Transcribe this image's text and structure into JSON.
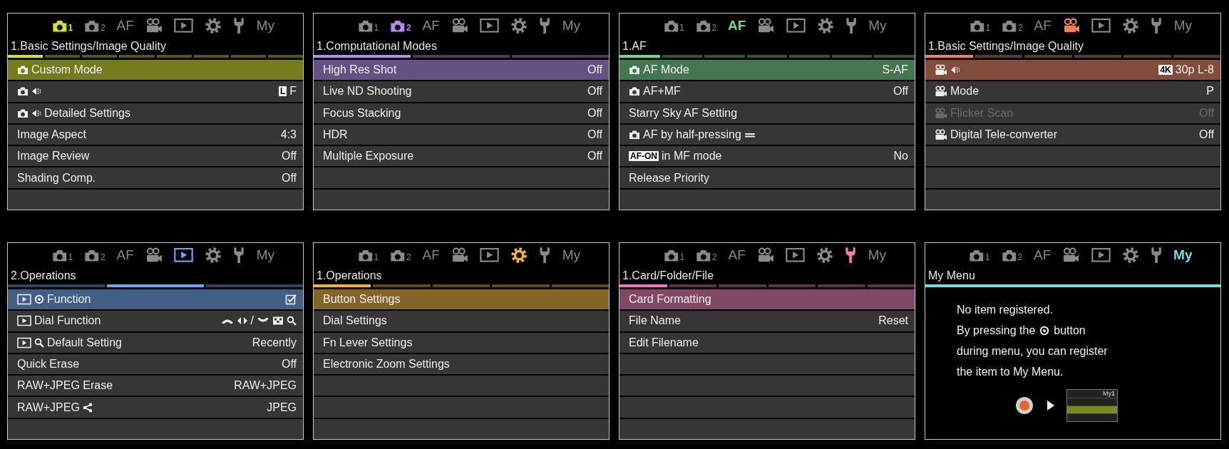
{
  "panels": [
    {
      "kind": "list",
      "color": "#d6e51f",
      "heading": "1.Basic Settings/Image Quality",
      "tabs": [
        {
          "kind": "camera",
          "sub": "1",
          "selected": true
        },
        {
          "kind": "camera",
          "sub": "2",
          "selected": false
        },
        {
          "kind": "text",
          "label": "AF",
          "selected": false
        },
        {
          "kind": "movie",
          "selected": false
        },
        {
          "kind": "play",
          "selected": false
        },
        {
          "kind": "gear",
          "selected": false
        },
        {
          "kind": "wrench",
          "selected": false
        },
        {
          "kind": "text",
          "label": "My",
          "selected": false
        }
      ],
      "segments": [
        {
          "selected": true
        },
        {
          "selected": false
        },
        {
          "selected": false
        },
        {
          "selected": false
        },
        {
          "selected": false
        },
        {
          "selected": false
        },
        {
          "selected": false
        },
        {
          "selected": false
        }
      ],
      "rows": [
        {
          "selected": true,
          "disabled": false,
          "label": [
            {
              "kind": "camera"
            },
            {
              "kind": "text",
              "text": "Custom Mode"
            }
          ],
          "value": []
        },
        {
          "selected": false,
          "disabled": false,
          "label": [
            {
              "kind": "camera"
            },
            {
              "kind": "quality"
            }
          ],
          "value": [
            {
              "kind": "badge",
              "text": "L"
            },
            {
              "kind": "text",
              "text": "F"
            }
          ]
        },
        {
          "selected": false,
          "disabled": false,
          "label": [
            {
              "kind": "camera"
            },
            {
              "kind": "quality"
            },
            {
              "kind": "text",
              "text": "Detailed Settings"
            }
          ],
          "value": []
        },
        {
          "selected": false,
          "disabled": false,
          "label": [
            {
              "kind": "text",
              "text": "Image Aspect"
            }
          ],
          "value": [
            {
              "kind": "text",
              "text": "4:3"
            }
          ]
        },
        {
          "selected": false,
          "disabled": false,
          "label": [
            {
              "kind": "text",
              "text": "Image Review"
            }
          ],
          "value": [
            {
              "kind": "text",
              "text": "Off"
            }
          ]
        },
        {
          "selected": false,
          "disabled": false,
          "label": [
            {
              "kind": "text",
              "text": "Shading Comp."
            }
          ],
          "value": [
            {
              "kind": "text",
              "text": "Off"
            }
          ]
        }
      ]
    },
    {
      "kind": "list",
      "color": "#b48cf0",
      "heading": "1.Computational Modes",
      "tabs": [
        {
          "kind": "camera",
          "sub": "1",
          "selected": false
        },
        {
          "kind": "camera",
          "sub": "2",
          "selected": true
        },
        {
          "kind": "text",
          "label": "AF",
          "selected": false
        },
        {
          "kind": "movie",
          "selected": false
        },
        {
          "kind": "play",
          "selected": false
        },
        {
          "kind": "gear",
          "selected": false
        },
        {
          "kind": "wrench",
          "selected": false
        },
        {
          "kind": "text",
          "label": "My",
          "selected": false
        }
      ],
      "segments": [
        {
          "selected": true
        },
        {
          "selected": false
        },
        {
          "selected": false
        }
      ],
      "rows": [
        {
          "selected": true,
          "disabled": false,
          "label": [
            {
              "kind": "text",
              "text": "High Res Shot"
            }
          ],
          "value": [
            {
              "kind": "text",
              "text": "Off"
            }
          ]
        },
        {
          "selected": false,
          "disabled": false,
          "label": [
            {
              "kind": "text",
              "text": "Live ND Shooting"
            }
          ],
          "value": [
            {
              "kind": "text",
              "text": "Off"
            }
          ]
        },
        {
          "selected": false,
          "disabled": false,
          "label": [
            {
              "kind": "text",
              "text": "Focus Stacking"
            }
          ],
          "value": [
            {
              "kind": "text",
              "text": "Off"
            }
          ]
        },
        {
          "selected": false,
          "disabled": false,
          "label": [
            {
              "kind": "text",
              "text": "HDR"
            }
          ],
          "value": [
            {
              "kind": "text",
              "text": "Off"
            }
          ]
        },
        {
          "selected": false,
          "disabled": false,
          "label": [
            {
              "kind": "text",
              "text": "Multiple Exposure"
            }
          ],
          "value": [
            {
              "kind": "text",
              "text": "Off"
            }
          ]
        }
      ]
    },
    {
      "kind": "list",
      "color": "#6fd98a",
      "heading": "1.AF",
      "tabs": [
        {
          "kind": "camera",
          "sub": "1",
          "selected": false
        },
        {
          "kind": "camera",
          "sub": "2",
          "selected": false
        },
        {
          "kind": "text",
          "label": "AF",
          "selected": true
        },
        {
          "kind": "movie",
          "selected": false
        },
        {
          "kind": "play",
          "selected": false
        },
        {
          "kind": "gear",
          "selected": false
        },
        {
          "kind": "wrench",
          "selected": false
        },
        {
          "kind": "text",
          "label": "My",
          "selected": false
        }
      ],
      "segments": [
        {
          "selected": true
        },
        {
          "selected": false
        },
        {
          "selected": false
        },
        {
          "selected": false
        },
        {
          "selected": false
        },
        {
          "selected": false
        },
        {
          "selected": false
        }
      ],
      "rows": [
        {
          "selected": true,
          "disabled": false,
          "label": [
            {
              "kind": "camera"
            },
            {
              "kind": "text",
              "text": "AF Mode"
            }
          ],
          "value": [
            {
              "kind": "text",
              "text": "S-AF"
            }
          ]
        },
        {
          "selected": false,
          "disabled": false,
          "label": [
            {
              "kind": "camera"
            },
            {
              "kind": "text",
              "text": "AF+MF"
            }
          ],
          "value": [
            {
              "kind": "text",
              "text": "Off"
            }
          ]
        },
        {
          "selected": false,
          "disabled": false,
          "label": [
            {
              "kind": "text",
              "text": "Starry Sky AF Setting"
            }
          ],
          "value": []
        },
        {
          "selected": false,
          "disabled": false,
          "label": [
            {
              "kind": "camera"
            },
            {
              "kind": "text",
              "text": "AF by half-pressing"
            },
            {
              "kind": "half"
            }
          ],
          "value": []
        },
        {
          "selected": false,
          "disabled": false,
          "label": [
            {
              "kind": "badge",
              "text": "AF-ON"
            },
            {
              "kind": "text",
              "text": "in MF mode"
            }
          ],
          "value": [
            {
              "kind": "text",
              "text": "No"
            }
          ]
        },
        {
          "selected": false,
          "disabled": false,
          "label": [
            {
              "kind": "text",
              "text": "Release Priority"
            }
          ],
          "value": []
        }
      ]
    },
    {
      "kind": "list",
      "color": "#f0805f",
      "heading": "1.Basic Settings/Image Quality",
      "tabs": [
        {
          "kind": "camera",
          "sub": "1",
          "selected": false
        },
        {
          "kind": "camera",
          "sub": "2",
          "selected": false
        },
        {
          "kind": "text",
          "label": "AF",
          "selected": false
        },
        {
          "kind": "movie",
          "selected": true
        },
        {
          "kind": "play",
          "selected": false
        },
        {
          "kind": "gear",
          "selected": false
        },
        {
          "kind": "wrench",
          "selected": false
        },
        {
          "kind": "text",
          "label": "My",
          "selected": false
        }
      ],
      "segments": [
        {
          "selected": true
        },
        {
          "selected": false
        },
        {
          "selected": false
        },
        {
          "selected": false
        },
        {
          "selected": false
        },
        {
          "selected": false
        }
      ],
      "rows": [
        {
          "selected": true,
          "disabled": false,
          "label": [
            {
              "kind": "movie"
            },
            {
              "kind": "quality"
            }
          ],
          "value": [
            {
              "kind": "badge",
              "text": "4K"
            },
            {
              "kind": "text",
              "text": "30p L-8"
            }
          ]
        },
        {
          "selected": false,
          "disabled": false,
          "label": [
            {
              "kind": "movie"
            },
            {
              "kind": "text",
              "text": "Mode"
            }
          ],
          "value": [
            {
              "kind": "text",
              "text": "P"
            }
          ]
        },
        {
          "selected": false,
          "disabled": true,
          "label": [
            {
              "kind": "movie"
            },
            {
              "kind": "text",
              "text": "Flicker Scan"
            }
          ],
          "value": [
            {
              "kind": "text",
              "text": "Off"
            }
          ]
        },
        {
          "selected": false,
          "disabled": false,
          "label": [
            {
              "kind": "movie"
            },
            {
              "kind": "text",
              "text": "Digital Tele-converter"
            }
          ],
          "value": [
            {
              "kind": "text",
              "text": "Off"
            }
          ]
        }
      ]
    },
    {
      "kind": "list",
      "color": "#6aa8f5",
      "heading": "2.Operations",
      "tabs": [
        {
          "kind": "camera",
          "sub": "1",
          "selected": false
        },
        {
          "kind": "camera",
          "sub": "2",
          "selected": false
        },
        {
          "kind": "text",
          "label": "AF",
          "selected": false
        },
        {
          "kind": "movie",
          "selected": false
        },
        {
          "kind": "play",
          "selected": true
        },
        {
          "kind": "gear",
          "selected": false
        },
        {
          "kind": "wrench",
          "selected": false
        },
        {
          "kind": "text",
          "label": "My",
          "selected": false
        }
      ],
      "segments": [
        {
          "selected": false
        },
        {
          "selected": true
        },
        {
          "selected": false
        }
      ],
      "rows": [
        {
          "selected": true,
          "disabled": false,
          "label": [
            {
              "kind": "play"
            },
            {
              "kind": "target"
            },
            {
              "kind": "text",
              "text": "Function"
            }
          ],
          "value": [
            {
              "kind": "checkbox",
              "checked": true
            }
          ]
        },
        {
          "selected": false,
          "disabled": false,
          "label": [
            {
              "kind": "play"
            },
            {
              "kind": "text",
              "text": "Dial Function"
            }
          ],
          "value": [
            {
              "kind": "dialup"
            },
            {
              "kind": "arrows"
            },
            {
              "kind": "text",
              "text": "/"
            },
            {
              "kind": "dialdown"
            },
            {
              "kind": "grid"
            },
            {
              "kind": "search"
            }
          ]
        },
        {
          "selected": false,
          "disabled": false,
          "label": [
            {
              "kind": "play"
            },
            {
              "kind": "search"
            },
            {
              "kind": "text",
              "text": "Default Setting"
            }
          ],
          "value": [
            {
              "kind": "text",
              "text": "Recently"
            }
          ]
        },
        {
          "selected": false,
          "disabled": false,
          "label": [
            {
              "kind": "text",
              "text": "Quick Erase"
            }
          ],
          "value": [
            {
              "kind": "text",
              "text": "Off"
            }
          ]
        },
        {
          "selected": false,
          "disabled": false,
          "label": [
            {
              "kind": "text",
              "text": "RAW+JPEG Erase"
            }
          ],
          "value": [
            {
              "kind": "text",
              "text": "RAW+JPEG"
            }
          ]
        },
        {
          "selected": false,
          "disabled": false,
          "label": [
            {
              "kind": "text",
              "text": "RAW+JPEG"
            },
            {
              "kind": "share"
            }
          ],
          "value": [
            {
              "kind": "text",
              "text": "JPEG"
            }
          ]
        }
      ]
    },
    {
      "kind": "list",
      "color": "#f5b534",
      "heading": "1.Operations",
      "tabs": [
        {
          "kind": "camera",
          "sub": "1",
          "selected": false
        },
        {
          "kind": "camera",
          "sub": "2",
          "selected": false
        },
        {
          "kind": "text",
          "label": "AF",
          "selected": false
        },
        {
          "kind": "movie",
          "selected": false
        },
        {
          "kind": "play",
          "selected": false
        },
        {
          "kind": "gear",
          "selected": true
        },
        {
          "kind": "wrench",
          "selected": false
        },
        {
          "kind": "text",
          "label": "My",
          "selected": false
        }
      ],
      "segments": [
        {
          "selected": true
        },
        {
          "selected": false
        },
        {
          "selected": false
        },
        {
          "selected": false
        },
        {
          "selected": false
        }
      ],
      "rows": [
        {
          "selected": true,
          "disabled": false,
          "label": [
            {
              "kind": "text",
              "text": "Button Settings"
            }
          ],
          "value": []
        },
        {
          "selected": false,
          "disabled": false,
          "label": [
            {
              "kind": "text",
              "text": "Dial Settings"
            }
          ],
          "value": []
        },
        {
          "selected": false,
          "disabled": false,
          "label": [
            {
              "kind": "text",
              "text": "Fn Lever Settings"
            }
          ],
          "value": []
        },
        {
          "selected": false,
          "disabled": false,
          "label": [
            {
              "kind": "text",
              "text": "Electronic Zoom Settings"
            }
          ],
          "value": []
        }
      ]
    },
    {
      "kind": "list",
      "color": "#f07ab5",
      "heading": "1.Card/Folder/File",
      "tabs": [
        {
          "kind": "camera",
          "sub": "1",
          "selected": false
        },
        {
          "kind": "camera",
          "sub": "2",
          "selected": false
        },
        {
          "kind": "text",
          "label": "AF",
          "selected": false
        },
        {
          "kind": "movie",
          "selected": false
        },
        {
          "kind": "play",
          "selected": false
        },
        {
          "kind": "gear",
          "selected": false
        },
        {
          "kind": "wrench",
          "selected": true
        },
        {
          "kind": "text",
          "label": "My",
          "selected": false
        }
      ],
      "segments": [
        {
          "selected": true
        },
        {
          "selected": false
        },
        {
          "selected": false
        },
        {
          "selected": false
        },
        {
          "selected": false
        },
        {
          "selected": false
        }
      ],
      "rows": [
        {
          "selected": true,
          "disabled": false,
          "label": [
            {
              "kind": "text",
              "text": "Card Formatting"
            }
          ],
          "value": []
        },
        {
          "selected": false,
          "disabled": false,
          "label": [
            {
              "kind": "text",
              "text": "File Name"
            }
          ],
          "value": [
            {
              "kind": "text",
              "text": "Reset"
            }
          ]
        },
        {
          "selected": false,
          "disabled": false,
          "label": [
            {
              "kind": "text",
              "text": "Edit Filename"
            }
          ],
          "value": []
        }
      ]
    },
    {
      "kind": "message",
      "color": "#7fd8e0",
      "heading": "My Menu",
      "tabs": [
        {
          "kind": "camera",
          "sub": "1",
          "selected": false
        },
        {
          "kind": "camera",
          "sub": "2",
          "selected": false
        },
        {
          "kind": "text",
          "label": "AF",
          "selected": false
        },
        {
          "kind": "movie",
          "selected": false
        },
        {
          "kind": "play",
          "selected": false
        },
        {
          "kind": "gear",
          "selected": false
        },
        {
          "kind": "wrench",
          "selected": false
        },
        {
          "kind": "text",
          "label": "My",
          "selected": true
        }
      ],
      "segments": [
        {
          "selected": true
        }
      ],
      "lines": [
        [
          {
            "kind": "text",
            "text": "No item registered."
          }
        ],
        [
          {
            "kind": "text",
            "text": "By pressing the"
          },
          {
            "kind": "target"
          },
          {
            "kind": "text",
            "text": "button"
          }
        ],
        [
          {
            "kind": "text",
            "text": "during menu, you can register"
          }
        ],
        [
          {
            "kind": "text",
            "text": "the item to My Menu."
          }
        ]
      ],
      "thumbnail_tab": "My**1**"
    }
  ]
}
